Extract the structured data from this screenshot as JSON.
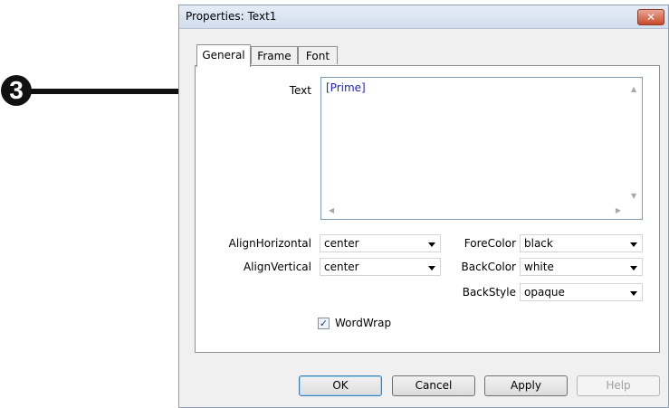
{
  "callout": {
    "number": "3"
  },
  "dialog": {
    "title": "Properties: Text1",
    "close_glyph": "✕",
    "tabs": [
      {
        "label": "General",
        "active": true
      },
      {
        "label": "Frame",
        "active": false
      },
      {
        "label": "Font",
        "active": false
      }
    ],
    "text_field": {
      "label": "Text",
      "value": "[Prime]"
    },
    "align_horizontal": {
      "label": "AlignHorizontal",
      "value": "center"
    },
    "align_vertical": {
      "label": "AlignVertical",
      "value": "center"
    },
    "fore_color": {
      "label": "ForeColor",
      "value": "black"
    },
    "back_color": {
      "label": "BackColor",
      "value": "white"
    },
    "back_style": {
      "label": "BackStyle",
      "value": "opaque"
    },
    "word_wrap": {
      "label": "WordWrap",
      "checked": true
    },
    "buttons": {
      "ok": "OK",
      "cancel": "Cancel",
      "apply": "Apply",
      "help": "Help"
    }
  }
}
